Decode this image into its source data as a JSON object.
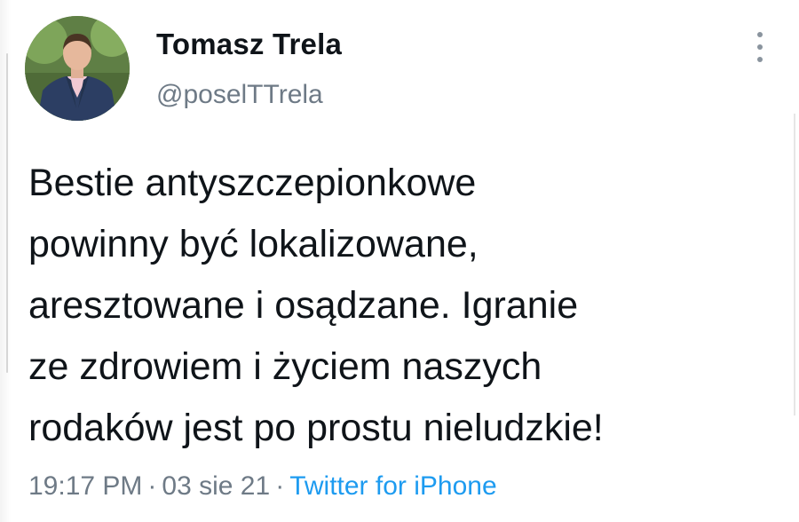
{
  "tweet": {
    "author": {
      "display_name": "Tomasz Trela",
      "handle": "@poselTTrela",
      "avatar": "profile-photo"
    },
    "menu_icon": "more-vertical-icon",
    "text": "Bestie antyszczepionkowe\npowinny być lokalizowane,\naresztowane i osądzane. Igranie\nze zdrowiem i życiem naszych\nrodaków jest po prostu nieludzkie!",
    "time": "19:17 PM",
    "separator": "·",
    "date": "03 sie 21",
    "source": "Twitter for iPhone"
  },
  "colors": {
    "text": "#0f1419",
    "secondary": "#6e7a86",
    "link": "#1d9bf0"
  }
}
